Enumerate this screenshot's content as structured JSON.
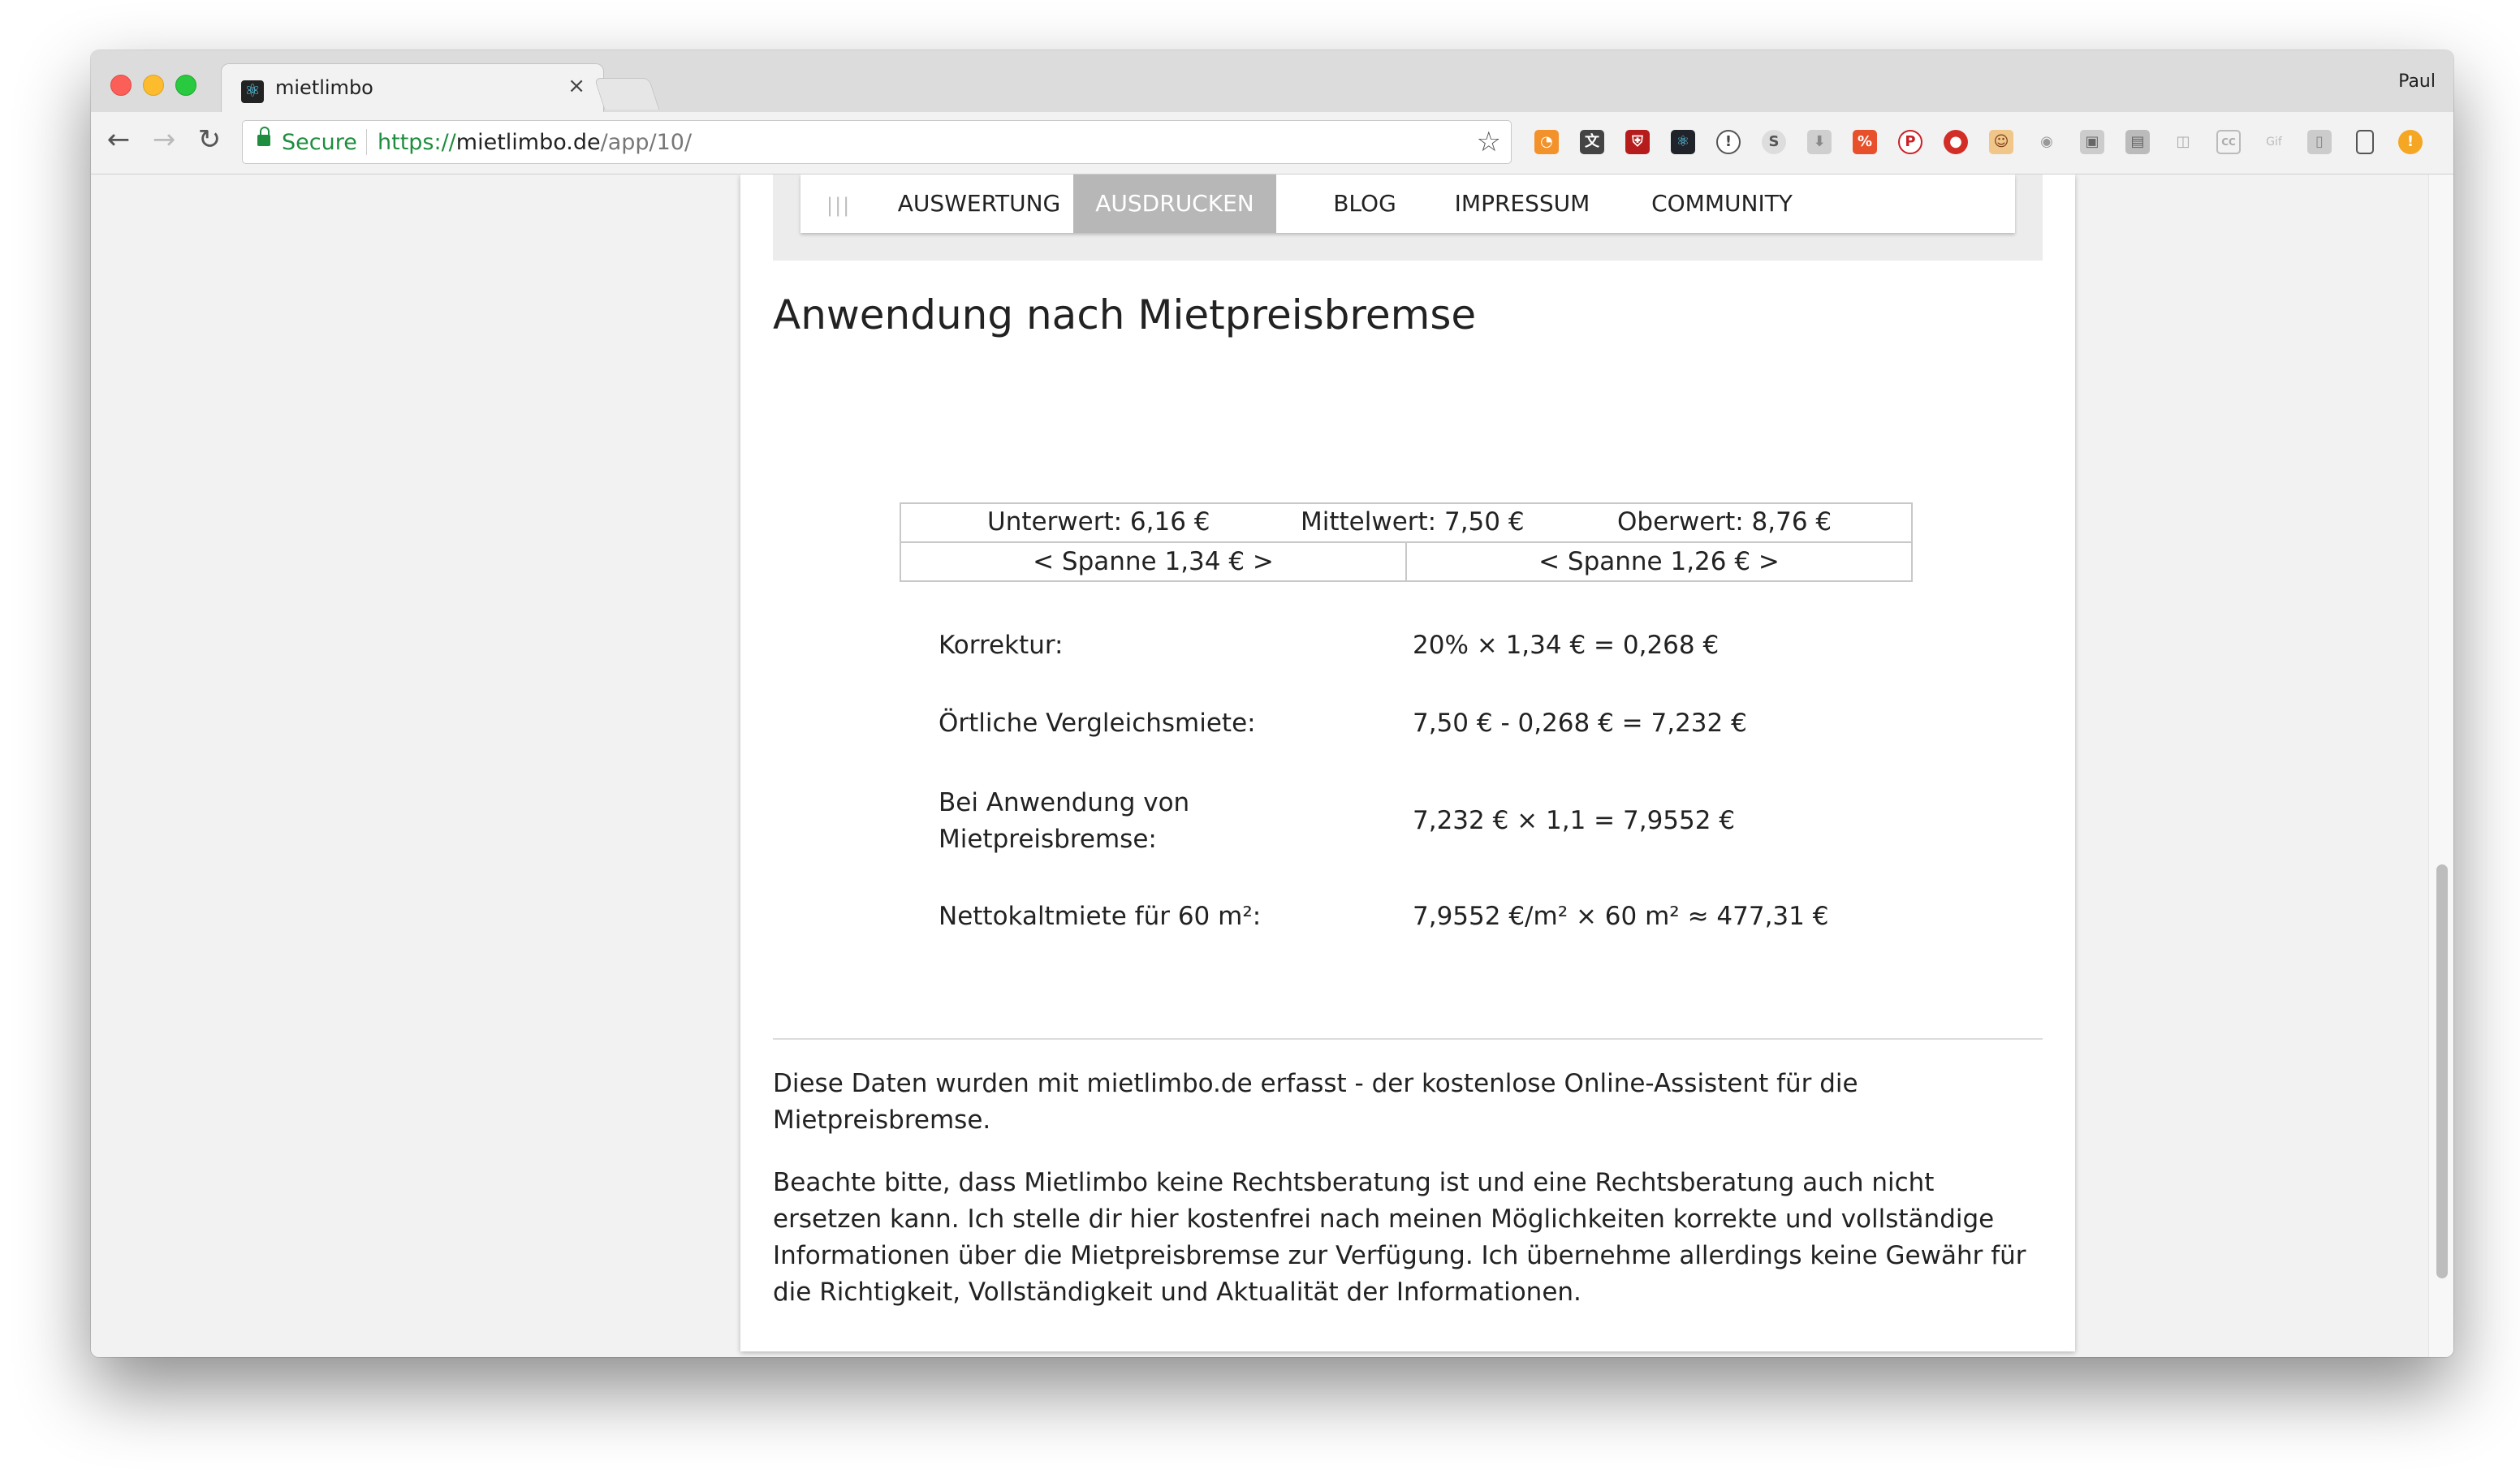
{
  "browser": {
    "tab_title": "mietlimbo",
    "tab_close": "×",
    "profile_name": "Paul",
    "secure_label": "Secure",
    "url_scheme": "https://",
    "url_host": "mietlimbo.de",
    "url_path": "/app/10/",
    "accent_secure": "#1e8e3e",
    "extensions": [
      "rss-icon",
      "translate-icon",
      "shield-icon",
      "react-devtools-icon",
      "onepassword-icon",
      "skype-icon",
      "download-icon",
      "todoist-icon",
      "pinterest-icon",
      "lastpass-icon",
      "face-icon",
      "reddit-icon",
      "camera-icon",
      "printer-icon",
      "chat-icon",
      "cc-icon",
      "gif-icon",
      "trash-icon",
      "phone-icon",
      "warning-icon"
    ]
  },
  "nav": {
    "handle": "|||",
    "items": [
      {
        "label": "AUSWERTUNG",
        "active": false
      },
      {
        "label": "AUSDRUCKEN",
        "active": true
      },
      {
        "label": "BLOG",
        "active": false
      },
      {
        "label": "IMPRESSUM",
        "active": false
      },
      {
        "label": "COMMUNITY",
        "active": false
      }
    ]
  },
  "page": {
    "heading": "Anwendung nach Mietpreisbremse",
    "range": {
      "unterwert": "Unterwert: 6,16 €",
      "mittelwert": "Mittelwert: 7,50 €",
      "oberwert": "Oberwert: 8,76 €",
      "spanne_left": "< Spanne 1,34 € >",
      "spanne_right": "< Spanne 1,26 € >"
    },
    "calculations": [
      {
        "label": "Korrektur:",
        "value": "20% × 1,34 € = 0,268 €"
      },
      {
        "label": "Örtliche Vergleichsmiete:",
        "value": "7,50 € - 0,268 € = 7,232 €"
      },
      {
        "label_line1": "Bei Anwendung von",
        "label_line2": "Mietpreisbremse:",
        "value": "7,232 € × 1,1 = 7,9552 €"
      },
      {
        "label": "Nettokaltmiete für 60 m²:",
        "value": "7,9552 €/m² × 60 m² ≈ 477,31 €"
      }
    ],
    "footer_text_1": "Diese Daten wurden mit mietlimbo.de erfasst - der kostenlose Online-Assistent für die Mietpreisbremse.",
    "footer_text_2": "Beachte bitte, dass Mietlimbo keine Rechtsberatung ist und eine Rechtsberatung auch nicht ersetzen kann. Ich stelle dir hier kostenfrei nach meinen Möglichkeiten korrekte und vollständige Informationen über die Mietpreisbremse zur Verfügung. Ich übernehme allerdings keine Gewähr für die Richtigkeit, Vollständigkeit und Aktualität der Informationen."
  }
}
